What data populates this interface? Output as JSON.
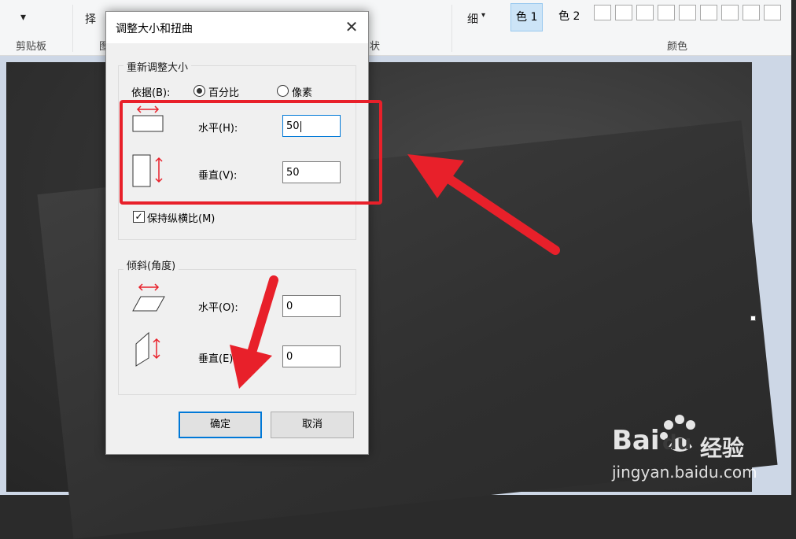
{
  "ribbon": {
    "dropdown_glyph": "▾",
    "select_label": "择",
    "group_clipboard": "剪贴板",
    "group_image_partial": "图",
    "group_shapes_partial": "状",
    "size_label": "细",
    "color1_label": "色 1",
    "color2_label": "色 2",
    "group_colors": "颜色"
  },
  "dialog": {
    "title": "调整大小和扭曲",
    "close_glyph": "✕",
    "resize": {
      "legend": "重新调整大小",
      "by_label": "依据(B):",
      "percent_label": "百分比",
      "pixel_label": "像素",
      "horizontal_label": "水平(H):",
      "horizontal_value": "50",
      "vertical_label": "垂直(V):",
      "vertical_value": "50",
      "keep_aspect_label": "保持纵横比(M)",
      "keep_aspect_checked": true
    },
    "skew": {
      "legend": "倾斜(角度)",
      "horizontal_label": "水平(O):",
      "horizontal_value": "0",
      "vertical_label": "垂直(E)",
      "vertical_value": "0"
    },
    "ok_label": "确定",
    "cancel_label": "取消"
  },
  "watermark": {
    "brand": "Bai",
    "brand2": "du",
    "brand_cn": "经验",
    "url": "jingyan.baidu.com"
  },
  "colors": {
    "annotation_red": "#e8202a",
    "focus_blue": "#0078d7"
  }
}
